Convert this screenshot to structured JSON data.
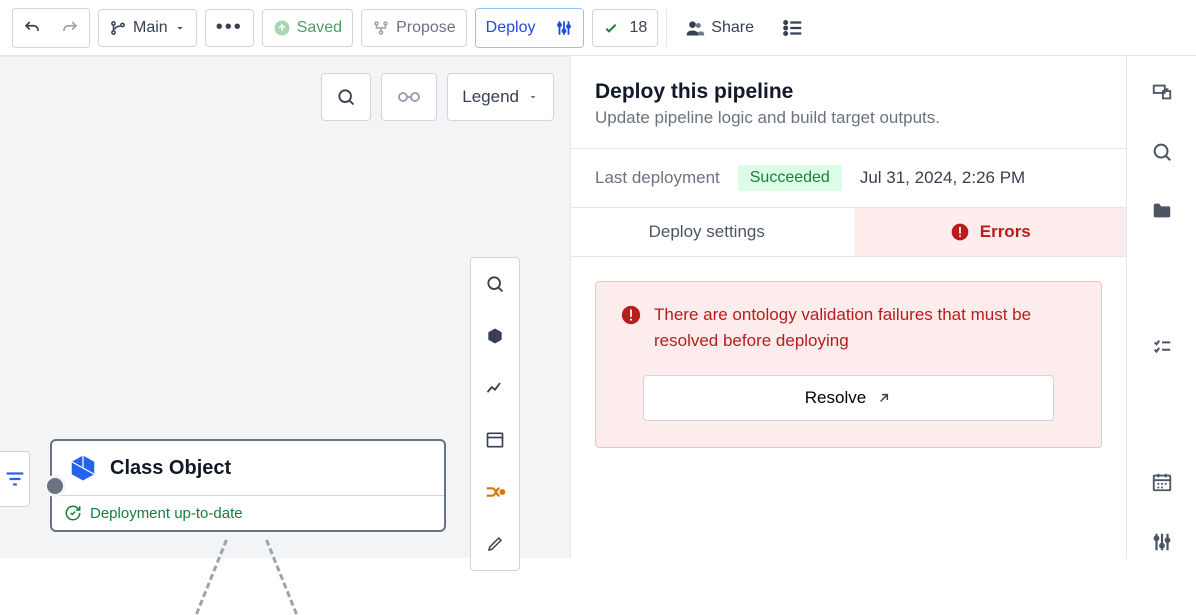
{
  "toolbar": {
    "branch": "Main",
    "saved": "Saved",
    "propose": "Propose",
    "deploy": "Deploy",
    "check_count": "18",
    "share": "Share"
  },
  "canvas": {
    "legend": "Legend",
    "node_title": "Class Object",
    "node_status": "Deployment up-to-date"
  },
  "panel": {
    "title": "Deploy this pipeline",
    "subtitle": "Update pipeline logic and build target outputs.",
    "last_deployment_label": "Last deployment",
    "last_status": "Succeeded",
    "last_time": "Jul 31, 2024, 2:26 PM",
    "tab_settings": "Deploy settings",
    "tab_errors": "Errors",
    "alert_msg": "There are ontology validation failures that must be resolved before deploying",
    "resolve": "Resolve"
  }
}
